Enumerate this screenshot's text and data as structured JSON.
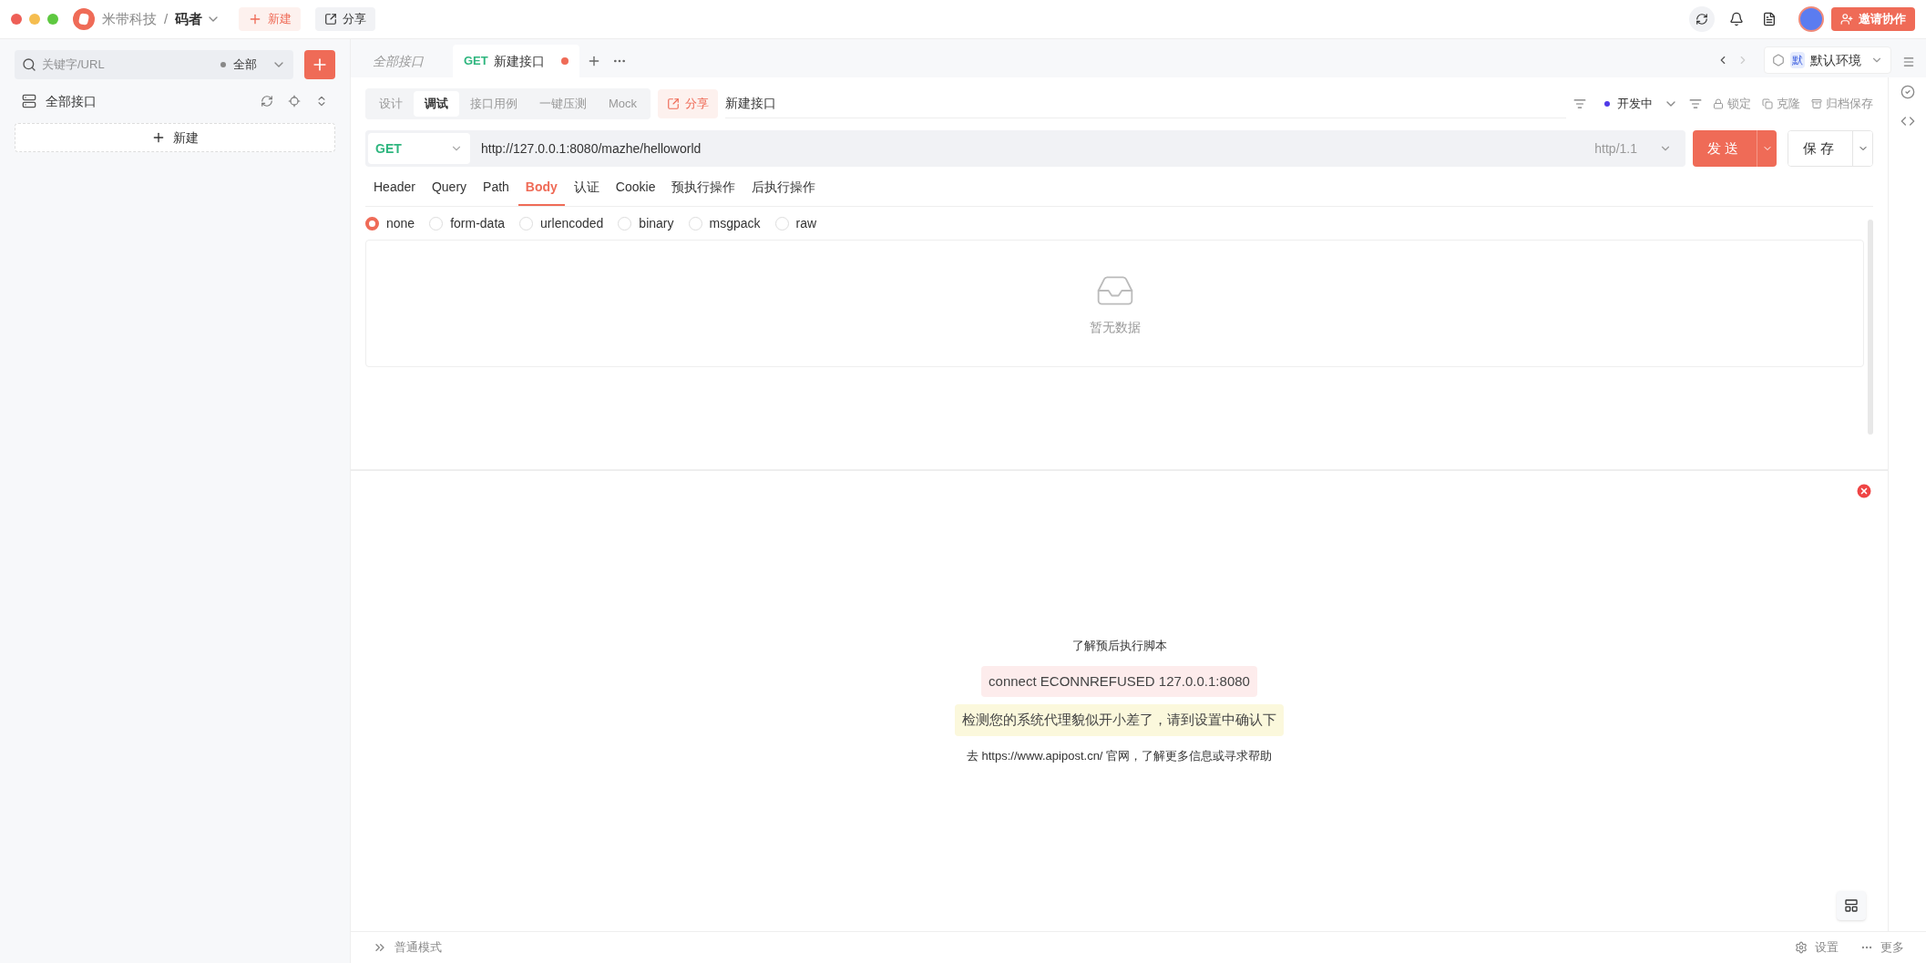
{
  "breadcrumb": {
    "org": "米带科技",
    "separator": "/",
    "project": "码者"
  },
  "top_buttons": [
    {
      "kind": "new",
      "label": "新建"
    },
    {
      "kind": "share",
      "label": "分享"
    }
  ],
  "invite_button": "邀请协作",
  "sidebar": {
    "search": {
      "placeholder": "关键字/URL"
    },
    "filter": "全部",
    "tree_root": "全部接口",
    "new_button": "新建"
  },
  "tabs": [
    {
      "kind": "overview",
      "label": "全部接口",
      "selected": false
    },
    {
      "kind": "request",
      "method": "GET",
      "label": "新建接口",
      "selected": true,
      "unsaved": true
    }
  ],
  "environment": {
    "badge": "默",
    "label": "默认环境"
  },
  "mode_tabs": [
    {
      "label": "设计",
      "selected": false
    },
    {
      "label": "调试",
      "selected": true
    },
    {
      "label": "接口用例",
      "selected": false
    },
    {
      "label": "一键压测",
      "selected": false
    },
    {
      "label": "Mock",
      "selected": false
    }
  ],
  "share_button": "分享",
  "request_name": "新建接口",
  "status": "开发中",
  "actions": [
    "锁定",
    "克隆",
    "归档保存"
  ],
  "url_bar": {
    "method": "GET",
    "url": "http://127.0.0.1:8080/mazhe/helloworld",
    "protocol": "http/1.1",
    "send": "发送",
    "save": "保存"
  },
  "body_tabs": [
    {
      "label": "Header",
      "selected": false
    },
    {
      "label": "Query",
      "selected": false
    },
    {
      "label": "Path",
      "selected": false
    },
    {
      "label": "Body",
      "selected": true
    },
    {
      "label": "认证",
      "selected": false
    },
    {
      "label": "Cookie",
      "selected": false
    },
    {
      "label": "预执行操作",
      "selected": false
    },
    {
      "label": "后执行操作",
      "selected": false
    }
  ],
  "body_types": [
    {
      "label": "none",
      "selected": true
    },
    {
      "label": "form-data",
      "selected": false
    },
    {
      "label": "urlencoded",
      "selected": false
    },
    {
      "label": "binary",
      "selected": false
    },
    {
      "label": "msgpack",
      "selected": false
    },
    {
      "label": "raw",
      "selected": false
    }
  ],
  "empty_text": "暂无数据",
  "response": {
    "messages": [
      {
        "kind": "plain",
        "text": "了解预后执行脚本"
      },
      {
        "kind": "error",
        "text": "connect ECONNREFUSED 127.0.0.1:8080"
      },
      {
        "kind": "warning",
        "text": "检测您的系统代理貌似开小差了，请到设置中确认下"
      },
      {
        "kind": "plain",
        "text": "去 https://www.apipost.cn/ 官网，了解更多信息或寻求帮助"
      }
    ]
  },
  "status_bar": {
    "mode": "普通模式",
    "settings": "设置",
    "more": "更多"
  }
}
